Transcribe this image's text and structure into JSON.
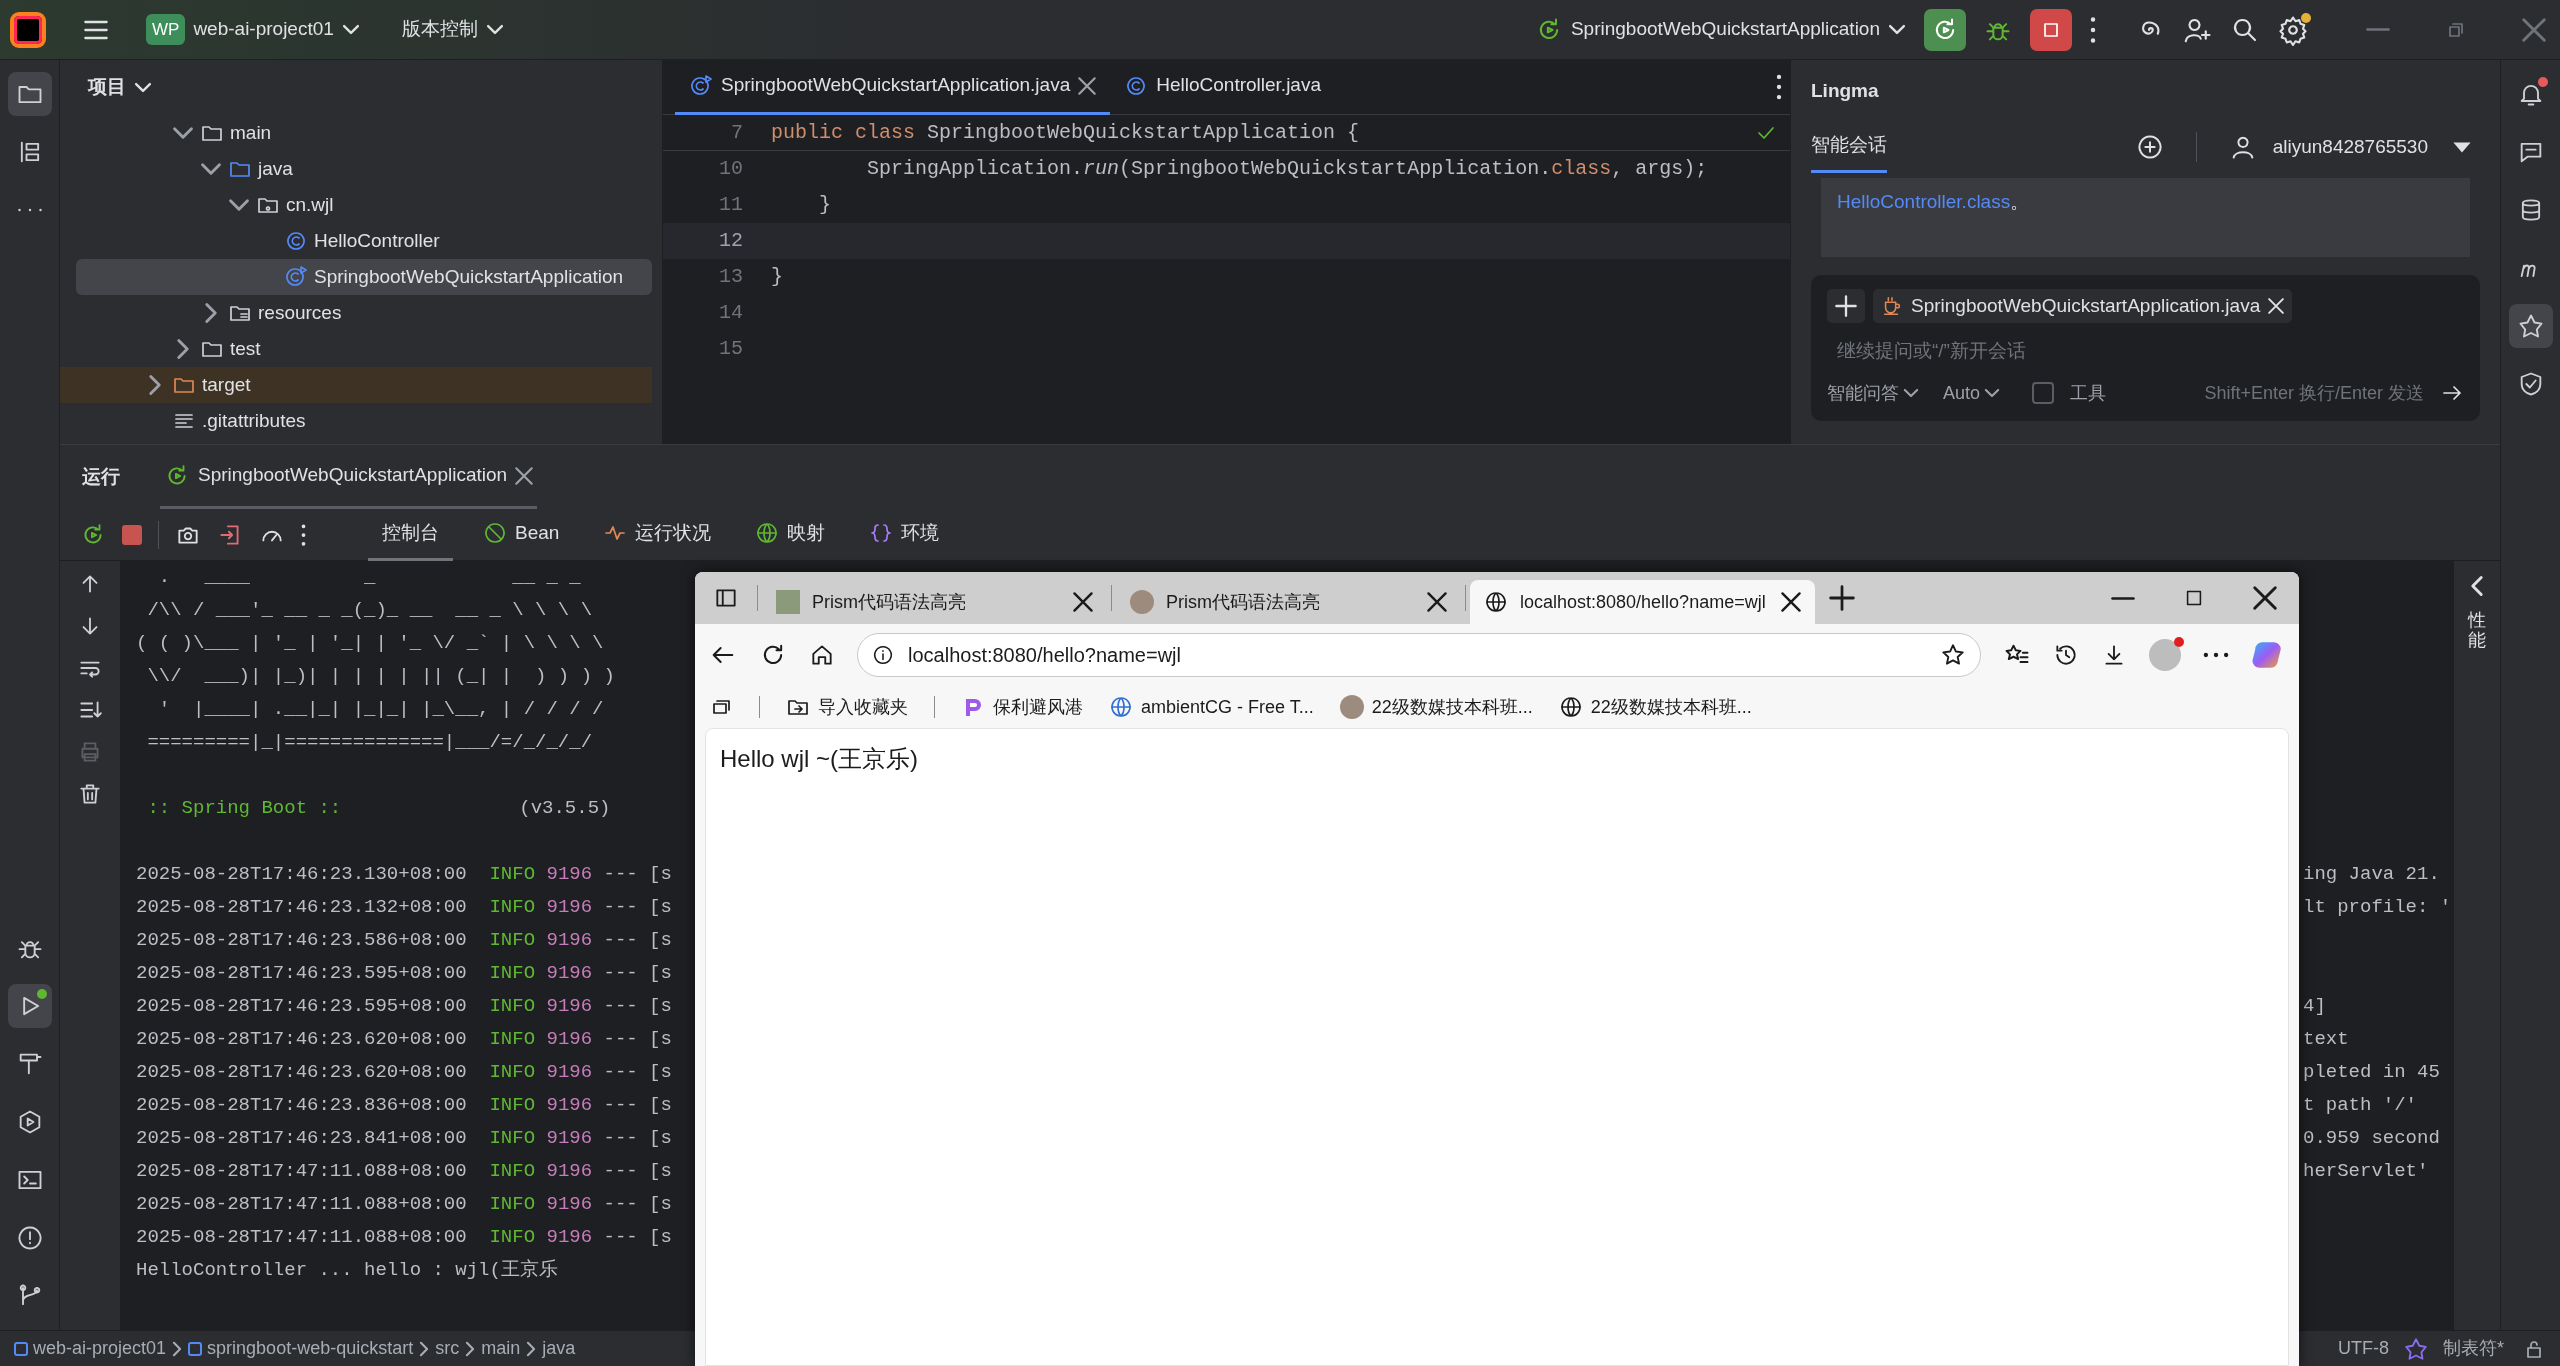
{
  "titlebar": {
    "project_badge": "WP",
    "project": "web-ai-project01",
    "vcs": "版本控制",
    "run_config": "SpringbootWebQuickstartApplication",
    "settings_badge": true
  },
  "left_toolbar": {
    "top": [
      {
        "kind": "project",
        "selected": true
      },
      {
        "kind": "structure",
        "selected": false
      },
      {
        "kind": "more",
        "selected": false
      }
    ],
    "bottom": [
      {
        "kind": "debug",
        "selected": false
      },
      {
        "kind": "run",
        "selected": true,
        "badge": true
      },
      {
        "kind": "build",
        "selected": false
      },
      {
        "kind": "services",
        "selected": false
      },
      {
        "kind": "terminal",
        "selected": false
      },
      {
        "kind": "problems",
        "selected": false
      },
      {
        "kind": "git",
        "selected": false
      }
    ]
  },
  "project_panel": {
    "title": "项目",
    "tree": [
      {
        "children": [
          {
            "label": "main",
            "kind": "folder",
            "expanded": true,
            "selected": false,
            "children": [
              {
                "label": "java",
                "kind": "source-folder",
                "expanded": true,
                "selected": false,
                "children": [
                  {
                    "label": "cn.wjl",
                    "kind": "package",
                    "expanded": true,
                    "selected": false,
                    "children": [
                      {
                        "label": "HelloController",
                        "kind": "class",
                        "selected": false
                      },
                      {
                        "label": "SpringbootWebQuickstartApplication",
                        "kind": "main-class",
                        "selected": true
                      }
                    ]
                  }
                ]
              },
              {
                "label": "resources",
                "kind": "resource-folder",
                "expanded": false,
                "selected": false
              }
            ]
          },
          {
            "label": "test",
            "kind": "folder",
            "expanded": false,
            "selected": false
          }
        ]
      },
      {
        "label": "target",
        "kind": "excluded-folder",
        "expanded": false,
        "selected": false
      },
      {
        "label": ".gitattributes",
        "kind": "file",
        "selected": false
      }
    ]
  },
  "editor": {
    "tabs": [
      {
        "label": "SpringbootWebQuickstartApplication.java",
        "kind": "main-class",
        "selected": true
      },
      {
        "label": "HelloController.java",
        "kind": "class",
        "selected": false
      }
    ],
    "lines": [
      {
        "number": "7",
        "current": false,
        "tokens": [
          {
            "text": "public class ",
            "kind": "keyword"
          },
          {
            "text": "SpringbootWebQuickstartApplication {",
            "kind": "plain"
          }
        ]
      },
      {
        "number": "10",
        "current": false,
        "tokens": [
          {
            "text": "        SpringApplication.",
            "kind": "plain"
          },
          {
            "text": "run",
            "kind": "method"
          },
          {
            "text": "(SpringbootWebQuickstartApplication.",
            "kind": "plain"
          },
          {
            "text": "class",
            "kind": "keyword"
          },
          {
            "text": ", args);",
            "kind": "plain"
          }
        ]
      },
      {
        "number": "11",
        "current": false,
        "tokens": [
          {
            "text": "    }",
            "kind": "plain"
          }
        ]
      },
      {
        "number": "12",
        "current": true
      },
      {
        "number": "13",
        "current": false,
        "tokens": [
          {
            "text": "}",
            "kind": "plain"
          }
        ]
      },
      {
        "number": "14",
        "current": false
      },
      {
        "number": "15",
        "current": false
      }
    ]
  },
  "lingma": {
    "title": "Lingma",
    "tabs": [
      {
        "label": "智能会话",
        "selected": true
      }
    ],
    "user": "aliyun8428765530",
    "message_link": "HelloController.class",
    "message_tail": "。",
    "input": {
      "attachment": "SpringbootWebQuickstartApplication.java",
      "placeholder": "继续提问或“/”新开会话",
      "mode": "智能问答",
      "model": "Auto",
      "tools": {
        "label": "工具",
        "checked": false
      },
      "hint": "Shift+Enter 换行/Enter 发送"
    }
  },
  "right_toolbar": [
    {
      "kind": "notifications",
      "selected": false,
      "badge": true
    },
    {
      "kind": "chat",
      "selected": false
    },
    {
      "kind": "database",
      "selected": false
    },
    {
      "kind": "maven",
      "selected": false
    },
    {
      "kind": "assistant",
      "selected": true
    },
    {
      "kind": "security",
      "selected": false
    }
  ],
  "run_panel": {
    "title": "运行",
    "tab": "SpringbootWebQuickstartApplication",
    "tool_tabs": [
      {
        "label": "控制台",
        "kind": "console",
        "selected": true
      },
      {
        "label": "Bean",
        "kind": "bean",
        "selected": false
      },
      {
        "label": "运行状况",
        "kind": "health",
        "selected": false
      },
      {
        "label": "映射",
        "kind": "mappings",
        "selected": false
      },
      {
        "label": "环境",
        "kind": "environment",
        "selected": false
      }
    ],
    "banner": [
      "  .   ____          _            __ _ _",
      " /\\\\ / ___'_ __ _ _(_)_ __  __ _ \\ \\ \\ \\",
      "( ( )\\___ | '_ | '_| | '_ \\/ _` | \\ \\ \\ \\",
      " \\\\/  ___)| |_)| | | | | || (_| |  ) ) ) )",
      "  '  |____| .__|_| |_|_| |_\\__, | / / / /",
      " =========|_|==============|___/=/_/_/_/"
    ],
    "boot_label": " :: Spring Boot ::",
    "boot_version": "(v3.5.5)",
    "logs": [
      {
        "timestamp": "2025-08-28T17:46:23.130+08:00",
        "level": "INFO",
        "pid": "9196",
        "thread": "--- [s",
        "tail": "ing Java 21."
      },
      {
        "timestamp": "2025-08-28T17:46:23.132+08:00",
        "level": "INFO",
        "pid": "9196",
        "thread": "--- [s",
        "tail": "lt profile: '"
      },
      {
        "timestamp": "2025-08-28T17:46:23.586+08:00",
        "level": "INFO",
        "pid": "9196",
        "thread": "--- [s"
      },
      {
        "timestamp": "2025-08-28T17:46:23.595+08:00",
        "level": "INFO",
        "pid": "9196",
        "thread": "--- [s"
      },
      {
        "timestamp": "2025-08-28T17:46:23.595+08:00",
        "level": "INFO",
        "pid": "9196",
        "thread": "--- [s",
        "tail": "4]"
      },
      {
        "timestamp": "2025-08-28T17:46:23.620+08:00",
        "level": "INFO",
        "pid": "9196",
        "thread": "--- [s",
        "tail": "text"
      },
      {
        "timestamp": "2025-08-28T17:46:23.620+08:00",
        "level": "INFO",
        "pid": "9196",
        "thread": "--- [s",
        "tail": "pleted in 45"
      },
      {
        "timestamp": "2025-08-28T17:46:23.836+08:00",
        "level": "INFO",
        "pid": "9196",
        "thread": "--- [s",
        "tail": "t path '/'"
      },
      {
        "timestamp": "2025-08-28T17:46:23.841+08:00",
        "level": "INFO",
        "pid": "9196",
        "thread": "--- [s",
        "tail": "0.959 second"
      },
      {
        "timestamp": "2025-08-28T17:47:11.088+08:00",
        "level": "INFO",
        "pid": "9196",
        "thread": "--- [s",
        "tail": "herServlet'"
      },
      {
        "timestamp": "2025-08-28T17:47:11.088+08:00",
        "level": "INFO",
        "pid": "9196",
        "thread": "--- [s"
      },
      {
        "timestamp": "2025-08-28T17:47:11.088+08:00",
        "level": "INFO",
        "pid": "9196",
        "thread": "--- [s"
      }
    ],
    "output": "HelloController ... hello : wjl(王京乐",
    "side_label": "性能"
  },
  "browser": {
    "tabs": [
      {
        "title": "Prism代码语法高亮",
        "kind": "image",
        "selected": false
      },
      {
        "title": "Prism代码语法高亮",
        "kind": "avatar",
        "selected": false
      },
      {
        "title": "localhost:8080/hello?name=wjl",
        "kind": "globe",
        "selected": true
      }
    ],
    "address": "localhost:8080/hello?name=wjl",
    "profile_badge": true,
    "bookmarks": [
      {
        "label": "导入收藏夹",
        "kind": "import"
      },
      {
        "label": "保利避风港",
        "kind": "app"
      },
      {
        "label": "ambientCG - Free T...",
        "kind": "globe-blue"
      },
      {
        "label": "22级数媒技本科班...",
        "kind": "avatar"
      },
      {
        "label": "22级数媒技本科班...",
        "kind": "globe"
      }
    ],
    "content": "Hello wjl ~(王京乐)"
  },
  "status_bar": {
    "breadcrumbs": [
      {
        "label": "web-ai-project01",
        "kind": "module"
      },
      {
        "label": "springboot-web-quickstart",
        "kind": "module"
      },
      {
        "label": "src",
        "kind": "folder"
      },
      {
        "label": "main",
        "kind": "folder"
      },
      {
        "label": "java",
        "kind": "folder"
      }
    ],
    "encoding": "UTF-8",
    "indent": "制表符*"
  }
}
